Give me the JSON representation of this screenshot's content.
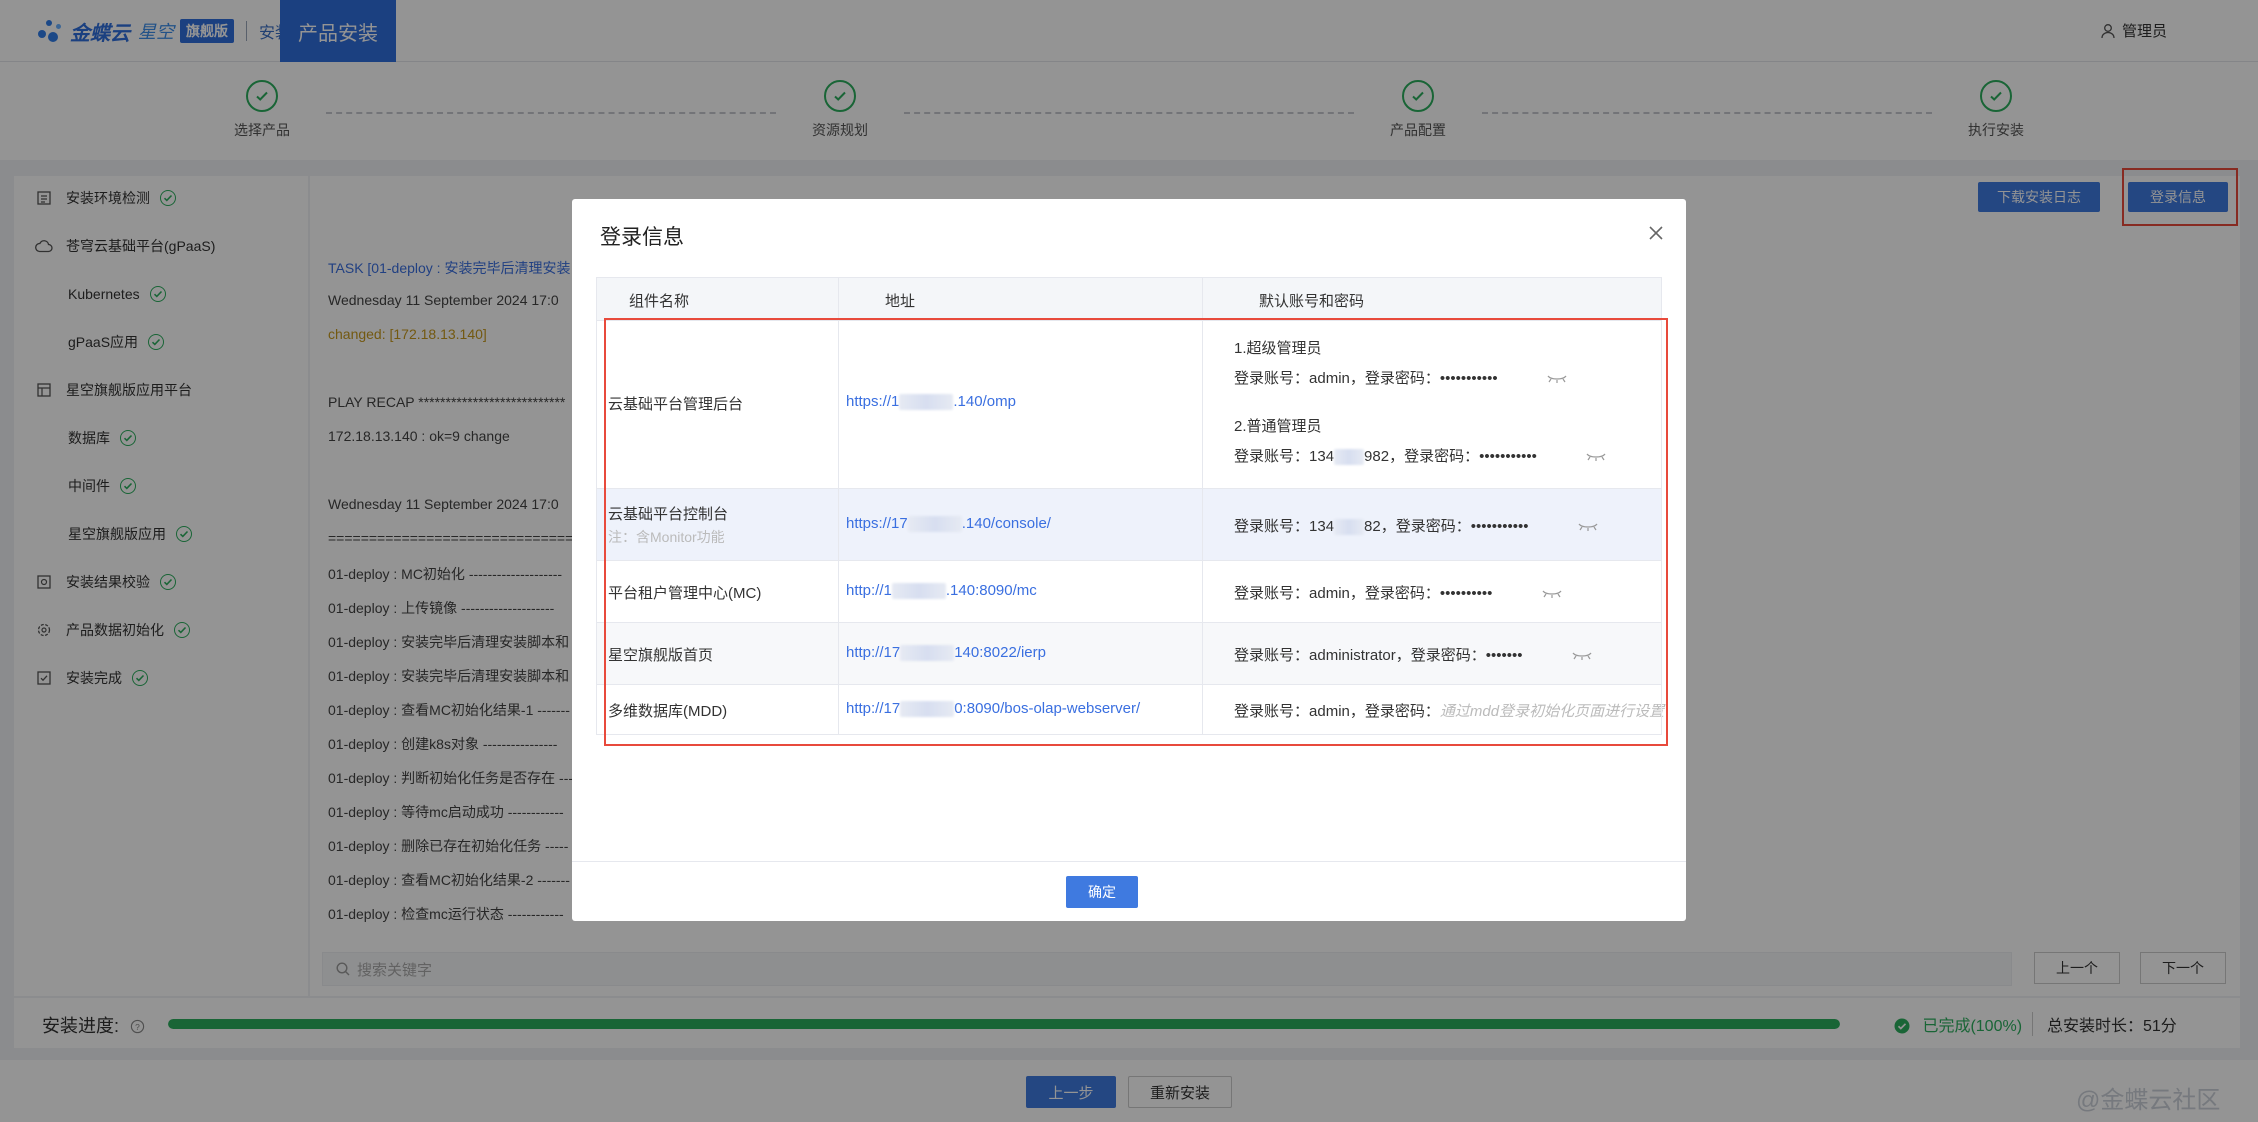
{
  "header": {
    "logo_text": "金蝶云",
    "logo_sub": "星空",
    "logo_badge": "旗舰版",
    "installer": "安装器",
    "tab": "产品安装",
    "user": "管理员"
  },
  "steps": [
    "选择产品",
    "资源规划",
    "产品配置",
    "执行安装"
  ],
  "sidebar": {
    "items": [
      {
        "label": "安装环境检测",
        "done": true,
        "icon": "checklist-icon"
      },
      {
        "label": "苍穹云基础平台(gPaaS)",
        "done": false,
        "icon": "cloud-icon"
      },
      {
        "label": "Kubernetes",
        "done": true,
        "sub": true
      },
      {
        "label": "gPaaS应用",
        "done": true,
        "sub": true
      },
      {
        "label": "星空旗舰版应用平台",
        "done": false,
        "icon": "grid-icon"
      },
      {
        "label": "数据库",
        "done": true,
        "sub": true
      },
      {
        "label": "中间件",
        "done": true,
        "sub": true
      },
      {
        "label": "星空旗舰版应用",
        "done": true,
        "sub": true
      },
      {
        "label": "安装结果校验",
        "done": true,
        "icon": "verify-icon"
      },
      {
        "label": "产品数据初始化",
        "done": true,
        "icon": "gear-icon"
      },
      {
        "label": "安装完成",
        "done": true,
        "icon": "complete-icon"
      }
    ]
  },
  "log": {
    "download_label": "下载安装日志",
    "login_info_label": "登录信息",
    "lines": [
      "TASK [01-deploy : 安装完毕后清理安装",
      "Wednesday 11 September 2024  17:0",
      "changed: [172.18.13.140]",
      "PLAY RECAP ***************************",
      "172.18.13.140            : ok=9    change",
      "Wednesday 11 September 2024  17:0",
      "========================================",
      "01-deploy : MC初始化 --------------------",
      "01-deploy : 上传镜像 --------------------",
      "01-deploy : 安装完毕后清理安装脚本和",
      "01-deploy : 安装完毕后清理安装脚本和",
      "01-deploy : 查看MC初始化结果-1 -------",
      "01-deploy : 创建k8s对象 ----------------",
      "01-deploy : 判断初始化任务是否存在 ---",
      "01-deploy : 等待mc启动成功 ------------",
      "01-deploy : 删除已存在初始化任务 -----",
      "01-deploy : 查看MC初始化结果-2 -------",
      "01-deploy : 检查mc运行状态 ------------"
    ],
    "search_placeholder": "搜索关键字",
    "prev_label": "上一个",
    "next_label": "下一个"
  },
  "progress": {
    "label": "安装进度:",
    "percent": 100,
    "done_text": "已完成(100%)",
    "total_text": "总安装时长：51分"
  },
  "footer": {
    "back_label": "上一步",
    "reinstall_label": "重新安装",
    "watermark": "@金蝶云社区"
  },
  "modal": {
    "title": "登录信息",
    "headers": [
      "组件名称",
      "地址",
      "默认账号和密码"
    ],
    "rows": [
      {
        "name": "云基础平台管理后台",
        "url": "https://1",
        "url_tail": ".140/omp",
        "groups": [
          {
            "title": "1.超级管理员",
            "account_label": "登录账号：",
            "account": "admin",
            "pwd_label": "，登录密码：",
            "pwd": "•••••••••••"
          },
          {
            "title": "2.普通管理员",
            "account_label": "登录账号：",
            "account": "134",
            "account_tail": "982",
            "pwd_label": "，登录密码：",
            "pwd": "•••••••••••"
          }
        ]
      },
      {
        "name": "云基础平台控制台",
        "note": "注：含Monitor功能",
        "url": "https://17",
        "url_tail": ".140/console/",
        "account_label": "登录账号：",
        "account": "134",
        "account_tail": "82",
        "pwd_label": "，登录密码：",
        "pwd": "•••••••••••"
      },
      {
        "name": "平台租户管理中心(MC)",
        "url": "http://1",
        "url_tail": ".140:8090/mc",
        "account_label": "登录账号：",
        "account": "admin",
        "pwd_label": "，登录密码：",
        "pwd": "••••••••••"
      },
      {
        "name": "星空旗舰版首页",
        "url": "http://17",
        "url_tail": "140:8022/ierp",
        "account_label": "登录账号：",
        "account": "administrator",
        "pwd_label": "，登录密码：",
        "pwd": "•••••••"
      },
      {
        "name": "多维数据库(MDD)",
        "url": "http://17",
        "url_tail": "0:8090/bos-olap-webserver/",
        "account_label": "登录账号：",
        "account": "admin",
        "pwd_label": "，登录密码：",
        "pwd_hint": "通过mdd登录初始化页面进行设置"
      }
    ],
    "ok_label": "确定"
  },
  "colors": {
    "primary": "#3f7ae0",
    "success": "#2cae5e",
    "highlight": "#e84a3c"
  }
}
